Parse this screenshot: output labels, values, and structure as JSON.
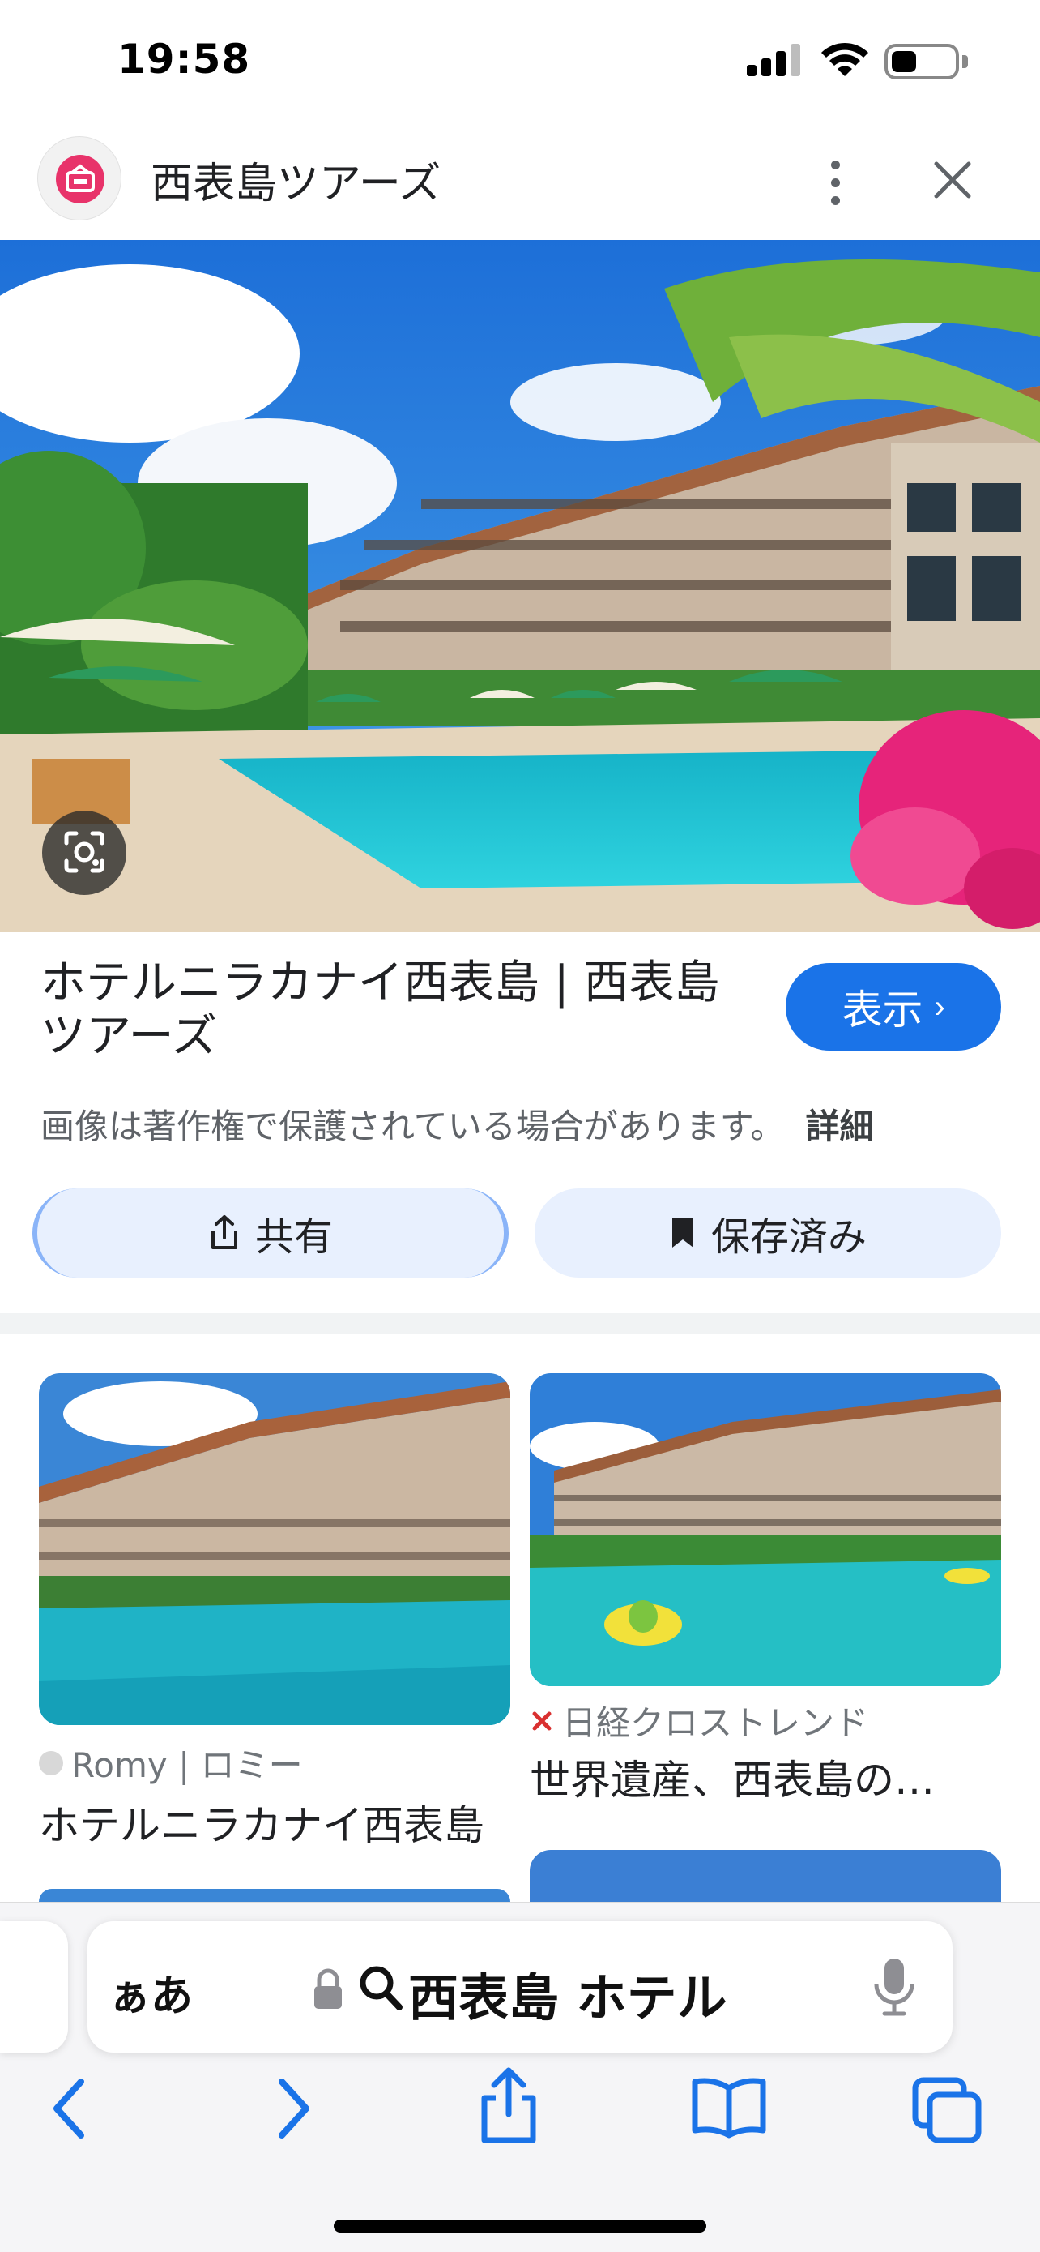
{
  "status_bar": {
    "time": "19:58",
    "battery_level": 0.4
  },
  "header": {
    "site_name": "西表島ツアーズ",
    "logo_icon": "tour-logo-icon",
    "more_icon": "more-vert-icon",
    "close_icon": "close-icon"
  },
  "hero": {
    "lens_icon": "lens-icon"
  },
  "result": {
    "title": "ホテルニラカナイ西表島 | 西表島ツアーズ",
    "visit_label": "表示",
    "copyright_text": "画像は著作権で保護されている場合があります。",
    "details_label": "詳細",
    "share_label": "共有",
    "saved_label": "保存済み"
  },
  "related": [
    {
      "source": "Romy | ロミー",
      "title": "ホテルニラカナイ西表島"
    },
    {
      "source": "日経クロストレンド",
      "title": "世界遺産、西表島の…"
    }
  ],
  "browser": {
    "aa_label": "ぁあ",
    "url_text": "西表島 ホテル",
    "back_icon": "back-icon",
    "forward_icon": "forward-icon",
    "share_icon": "share-icon",
    "bookmarks_icon": "bookmarks-icon",
    "tabs_icon": "tabs-icon"
  },
  "colors": {
    "accent": "#1a73e8",
    "chip_bg": "#e8f0fe",
    "logo": "#e8336a"
  }
}
